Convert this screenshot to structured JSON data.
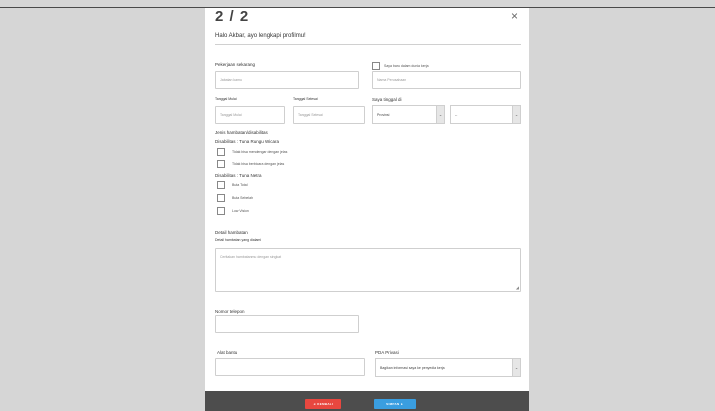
{
  "header": {
    "step": "2 / 2",
    "close_glyph": "×",
    "subtitle": "Halo Akbar, ayo lengkapi profilmu!"
  },
  "job": {
    "label": "Pekerjaan sekarang",
    "position_placeholder": "Jabatan kamu",
    "newbie_label": "Saya baru dalam dunia kerja",
    "company_placeholder": "Nama Perusahaan"
  },
  "dates": {
    "start_label": "Tanggal Mulai",
    "start_placeholder": "Tanggal Mulai",
    "end_label": "Tanggal Selesai",
    "end_placeholder": "Tanggal Selesai"
  },
  "location": {
    "label": "Saya tinggal di",
    "province_value": "Provinsi",
    "city_value": "--"
  },
  "disability": {
    "title": "Jenis hambatan/disabilitas",
    "groups": [
      {
        "label": "Disabilitas : Tuna Rungu Wicara",
        "options": [
          "Tidak bisa mendengar dengan jelas",
          "Tidak bisa berbicara dengan jelas"
        ]
      },
      {
        "label": "Disabilitas : Tuna Netra",
        "options": [
          "Buta Total",
          "Buta Sebelah",
          "Low Vision"
        ]
      }
    ]
  },
  "detail": {
    "label": "Detail hambatan",
    "sublabel": "Detail hambatan yang dialami",
    "placeholder": "Ceritakan hambatanmu dengan singkat"
  },
  "phone": {
    "label": "Nomor telepon"
  },
  "tools": {
    "label": "Alat bantu"
  },
  "privacy": {
    "label": "PDA Privasi",
    "value": "Bagikan informasi saya ke penyedia kerja"
  },
  "footer": {
    "back_label": "◄ KEMBALI",
    "save_label": "SIMPAN ►"
  },
  "colors": {
    "back_button": "#e8473f",
    "save_button": "#3a9ee0",
    "footer_bg": "#4d4d4d"
  }
}
